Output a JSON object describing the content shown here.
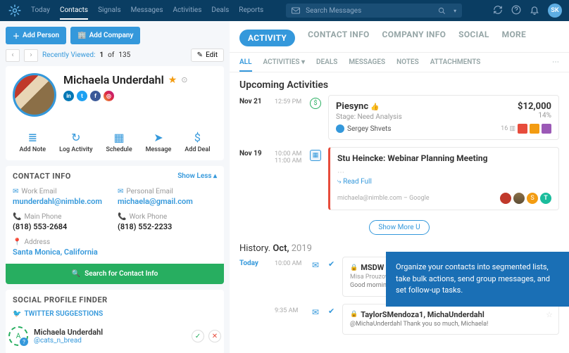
{
  "topnav": {
    "items": [
      "Today",
      "Contacts",
      "Signals",
      "Messages",
      "Activities",
      "Deals",
      "Reports"
    ],
    "active": "Contacts",
    "search_placeholder": "Search Messages",
    "user_initials": "SK"
  },
  "left": {
    "add_person": "Add Person",
    "add_company": "Add Company",
    "recently_viewed": "Recently Viewed:",
    "pager_pos": "1",
    "pager_of": "of",
    "pager_total": "135",
    "edit": "Edit",
    "name": "Michaela Underdahl",
    "quick_actions": [
      {
        "icon": "≣",
        "label": "Add Note"
      },
      {
        "icon": "↻",
        "label": "Log Activity"
      },
      {
        "icon": "▦",
        "label": "Schedule"
      },
      {
        "icon": "➤",
        "label": "Message"
      },
      {
        "icon": "$",
        "label": "Add Deal"
      }
    ],
    "contact_info_title": "CONTACT INFO",
    "show_less": "Show Less ▴",
    "contacts": {
      "work_email_label": "Work Email",
      "work_email": "munderdahl@nimble.com",
      "personal_email_label": "Personal Email",
      "personal_email": "michaela@gmail.com",
      "main_phone_label": "Main Phone",
      "main_phone": "(818) 553-2684",
      "work_phone_label": "Work Phone",
      "work_phone": "(818) 552-2233",
      "address_label": "Address",
      "address": "Santa Monica, California"
    },
    "search_contact": "Search for Contact Info",
    "spf_title": "SOCIAL PROFILE FINDER",
    "tw_sug_title": "TWITTER SUGGESTIONS",
    "suggestion": {
      "name": "Michaela Underdahl",
      "handle": "@cats_n_bread"
    }
  },
  "right": {
    "tabs_primary": [
      "ACTIVITY",
      "CONTACT INFO",
      "COMPANY INFO",
      "SOCIAL",
      "MORE"
    ],
    "tabs_secondary": [
      "ALL",
      "ACTIVITIES ▾",
      "DEALS",
      "MESSAGES",
      "NOTES",
      "ATTACHMENTS"
    ],
    "upcoming_title": "Upcoming Activities",
    "deal": {
      "date": "Nov 21",
      "time": "12:59 PM",
      "title": "Piesync",
      "amount": "$12,000",
      "stage": "Stage: Need Analysis",
      "pct": "14%",
      "owner": "Sergey Shvets",
      "people_count": "16 ▥"
    },
    "event": {
      "date": "Nov 19",
      "time1": "10:00 AM",
      "time2": "11:00 AM",
      "title": "Stu Heincke: Webinar Planning Meeting",
      "read_full": "Read Full",
      "src": "michaela@nimble.com – Google"
    },
    "show_more": "Show  More  U",
    "history_label": "History.",
    "history_month": "Oct,",
    "history_year": "2019",
    "msg1": {
      "date": "Today",
      "time": "10:00 AM",
      "title": "MSDW Webin",
      "from": "Misa Prouzova, SherV",
      "preview": "Good morning Yajas, So...\nresponse. Great for the da..."
    },
    "msg2": {
      "time": "9:35 AM",
      "title": "TaylorSMendoza1, MichaUnderdahl",
      "preview": "@MichaUnderdahl Thank you so much, Michaela!"
    }
  },
  "tooltip": "Organize your contacts into segmented lists, take bulk actions, send group messages, and set follow-up tasks."
}
